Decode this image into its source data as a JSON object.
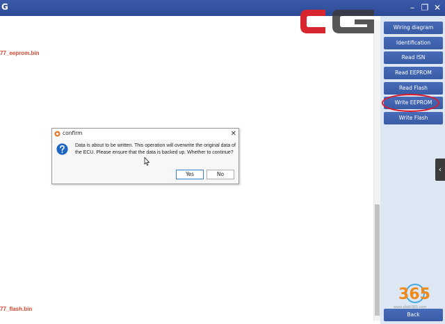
{
  "window": {
    "title_fragment": "G",
    "minimize_glyph": "–",
    "restore_glyph": "❐",
    "close_glyph": "✕"
  },
  "files": {
    "eeprom": "77_eeprom.bin",
    "flash": "77_flash.bin"
  },
  "panel": {
    "buttons": [
      {
        "label": "Wiring diagram"
      },
      {
        "label": "Identification"
      },
      {
        "label": "Read ISN"
      },
      {
        "label": "Read EEPROM"
      },
      {
        "label": "Read Flash"
      },
      {
        "label": "Write EEPROM"
      },
      {
        "label": "Write Flash"
      }
    ],
    "back_label": "Back",
    "collapse_glyph": "‹"
  },
  "dialog": {
    "title": "confirm",
    "close_glyph": "✕",
    "message": "Data is about to be written. This operation will overwrite the original data of the ECU. Please ensure that the data is backed up.  Whether to continue?",
    "yes_label": "Yes",
    "no_label": "No"
  },
  "watermark": {
    "digits": "365",
    "url": "www.obdii365.com"
  },
  "colors": {
    "accent": "#3a5ca6",
    "file_text": "#d6452f",
    "highlight": "#e0192a"
  }
}
